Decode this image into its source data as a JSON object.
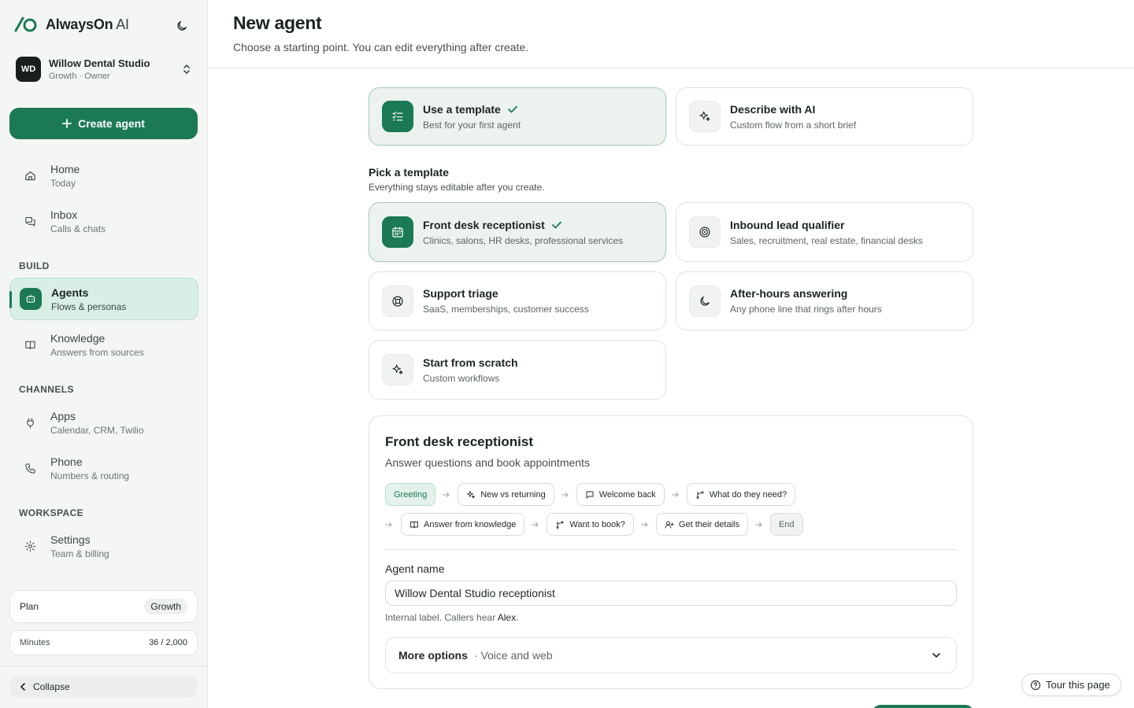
{
  "brand": {
    "name": "AlwaysOn",
    "suffix": " AI",
    "logo_icon": "alwayson-logo-icon",
    "theme_icon": "moon-icon"
  },
  "workspace": {
    "initials": "WD",
    "name": "Willow Dental Studio",
    "sub": "Growth · Owner"
  },
  "sidebar": {
    "create_label": "Create agent",
    "items": [
      {
        "label": "Home",
        "sub": "Today",
        "icon": "home-icon"
      },
      {
        "label": "Inbox",
        "sub": "Calls & chats",
        "icon": "chat-icon"
      },
      {
        "label": "Agents",
        "sub": "Flows & personas",
        "icon": "robot-icon",
        "active": true
      },
      {
        "label": "Knowledge",
        "sub": "Answers from sources",
        "icon": "book-icon"
      },
      {
        "label": "Apps",
        "sub": "Calendar, CRM, Twilio",
        "icon": "plug-icon"
      },
      {
        "label": "Phone",
        "sub": "Numbers & routing",
        "icon": "phone-icon"
      },
      {
        "label": "Settings",
        "sub": "Team & billing",
        "icon": "gear-icon"
      }
    ],
    "sections": {
      "build": "BUILD",
      "channels": "CHANNELS",
      "workspace": "WORKSPACE"
    },
    "plan": {
      "label": "Plan",
      "value": "Growth"
    },
    "minutes": {
      "label": "Minutes",
      "value": "36 / 2,000"
    },
    "collapse_label": "Collapse"
  },
  "header": {
    "title": "New agent",
    "subtitle": "Choose a starting point. You can edit everything after create."
  },
  "modes": [
    {
      "title": "Use a template",
      "sub": "Best for your first agent",
      "selected": true,
      "icon": "checklist-icon"
    },
    {
      "title": "Describe with AI",
      "sub": "Custom flow from a short brief",
      "selected": false,
      "icon": "sparkle-icon"
    }
  ],
  "pick": {
    "title": "Pick a template",
    "subtitle": "Everything stays editable after you create."
  },
  "templates": [
    {
      "title": "Front desk receptionist",
      "sub": "Clinics, salons, HR desks, professional services",
      "selected": true,
      "icon": "calendar-icon"
    },
    {
      "title": "Inbound lead qualifier",
      "sub": "Sales, recruitment, real estate, financial desks",
      "selected": false,
      "icon": "target-icon"
    },
    {
      "title": "Support triage",
      "sub": "SaaS, memberships, customer success",
      "selected": false,
      "icon": "lifebuoy-icon"
    },
    {
      "title": "After-hours answering",
      "sub": "Any phone line that rings after hours",
      "selected": false,
      "icon": "moon-icon"
    },
    {
      "title": "Start from scratch",
      "sub": "Custom workflows",
      "selected": false,
      "icon": "sparkle-icon"
    }
  ],
  "detail": {
    "title": "Front desk receptionist",
    "subtitle": "Answer questions and book appointments",
    "flow_row1": [
      {
        "label": "Greeting",
        "kind": "start"
      },
      {
        "label": "New vs returning",
        "icon": "sparkle-icon"
      },
      {
        "label": "Welcome back",
        "icon": "message-icon"
      },
      {
        "label": "What do they need?",
        "icon": "branch-icon"
      }
    ],
    "flow_row2": [
      {
        "label": "Answer from knowledge",
        "icon": "book-icon"
      },
      {
        "label": "Want to book?",
        "icon": "branch-icon"
      },
      {
        "label": "Get their details",
        "icon": "user-add-icon"
      },
      {
        "label": "End",
        "kind": "end"
      }
    ],
    "agent_name_label": "Agent name",
    "agent_name_value": "Willow Dental Studio receptionist",
    "help_prefix": "Internal label. Callers hear ",
    "help_name": "Alex",
    "help_suffix": ".",
    "more_options_title": "More options",
    "more_options_sub": "· Voice and web"
  },
  "tour_label": "Tour this page",
  "colors": {
    "accent": "#1b7a55",
    "accent_light": "#d9efe5",
    "sidebar_bg": "#f4f6f4"
  }
}
